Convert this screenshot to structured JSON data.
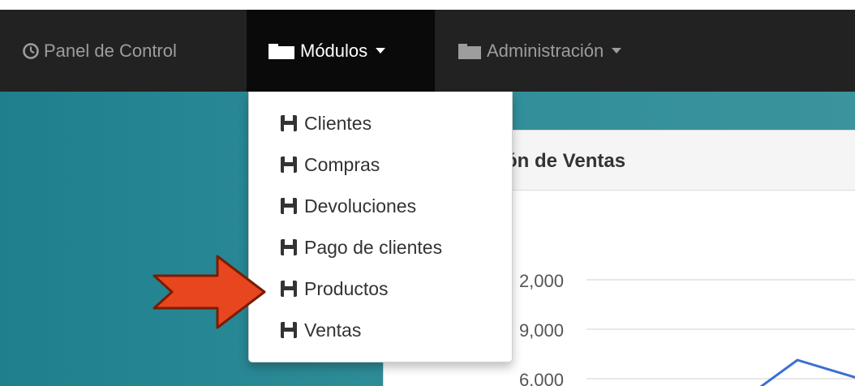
{
  "navbar": {
    "items": [
      {
        "label": "Panel de Control",
        "icon": "dashboard-icon"
      },
      {
        "label": "Módulos",
        "icon": "folder-icon",
        "active": true,
        "dropdown": true
      },
      {
        "label": "Administración",
        "icon": "folder-icon",
        "dropdown": true
      }
    ]
  },
  "modules_menu": {
    "items": [
      {
        "label": "Clientes",
        "icon": "floppy-disk-icon"
      },
      {
        "label": "Compras",
        "icon": "floppy-disk-icon"
      },
      {
        "label": "Devoluciones",
        "icon": "floppy-disk-icon"
      },
      {
        "label": "Pago de clientes",
        "icon": "floppy-disk-icon"
      },
      {
        "label": "Productos",
        "icon": "floppy-disk-icon",
        "highlighted_by_arrow": true
      },
      {
        "label": "Ventas",
        "icon": "floppy-disk-icon"
      }
    ]
  },
  "panel": {
    "title": "ción de Ventas"
  },
  "chart": {
    "tick_labels": [
      "2,000",
      "9,000",
      "6,000"
    ]
  },
  "colors": {
    "navbar": "#222222",
    "navbar_active": "#0a0a0a",
    "teal_background": "#2a8a96",
    "arrow": "#e8461e",
    "chart_line": "#3b6fd4"
  }
}
